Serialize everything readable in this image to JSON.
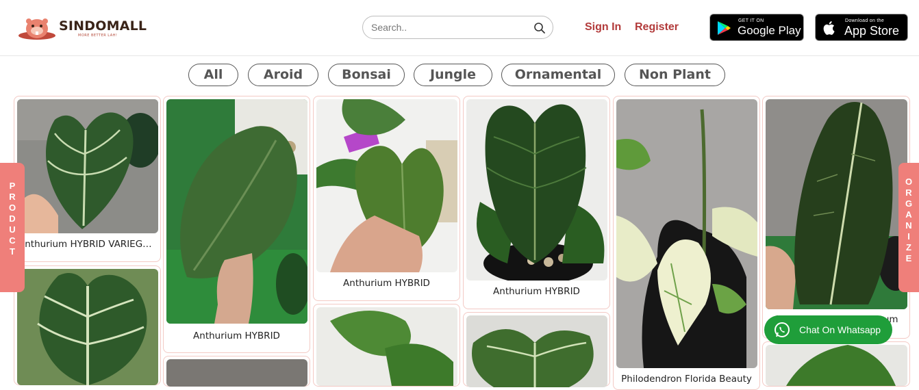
{
  "header": {
    "logo_text": "SINDOMALL",
    "logo_tagline": "MORE BETTER LAH!",
    "search_placeholder": "Search..",
    "sign_in": "Sign In",
    "register": "Register",
    "google_play_small": "GET IT ON",
    "google_play_big": "Google Play",
    "app_store_small": "Download on the",
    "app_store_big": "App Store"
  },
  "categories": [
    "All",
    "Aroid",
    "Bonsai",
    "Jungle",
    "Ornamental",
    "Non Plant"
  ],
  "products": [
    {
      "title": "Anthurium HYBRID VARIEGATA"
    },
    {
      "title": "Anthurium HYBRID"
    },
    {
      "title": "Anthurium HYBRID"
    },
    {
      "title": "Anthurium HYBRID"
    },
    {
      "title": "Philodendron Florida Beauty"
    },
    {
      "title": "Anthurium Warocqueanum"
    }
  ],
  "side_tabs": {
    "left": "PRODUCT",
    "right": "ORGANIZE"
  },
  "whatsapp": {
    "label": "Chat On Whatsapp"
  },
  "colors": {
    "accent": "#b23a3a",
    "side_tab": "#ef7f7a",
    "whatsapp": "#1f9e3a",
    "card_border": "#f3c9c4"
  }
}
